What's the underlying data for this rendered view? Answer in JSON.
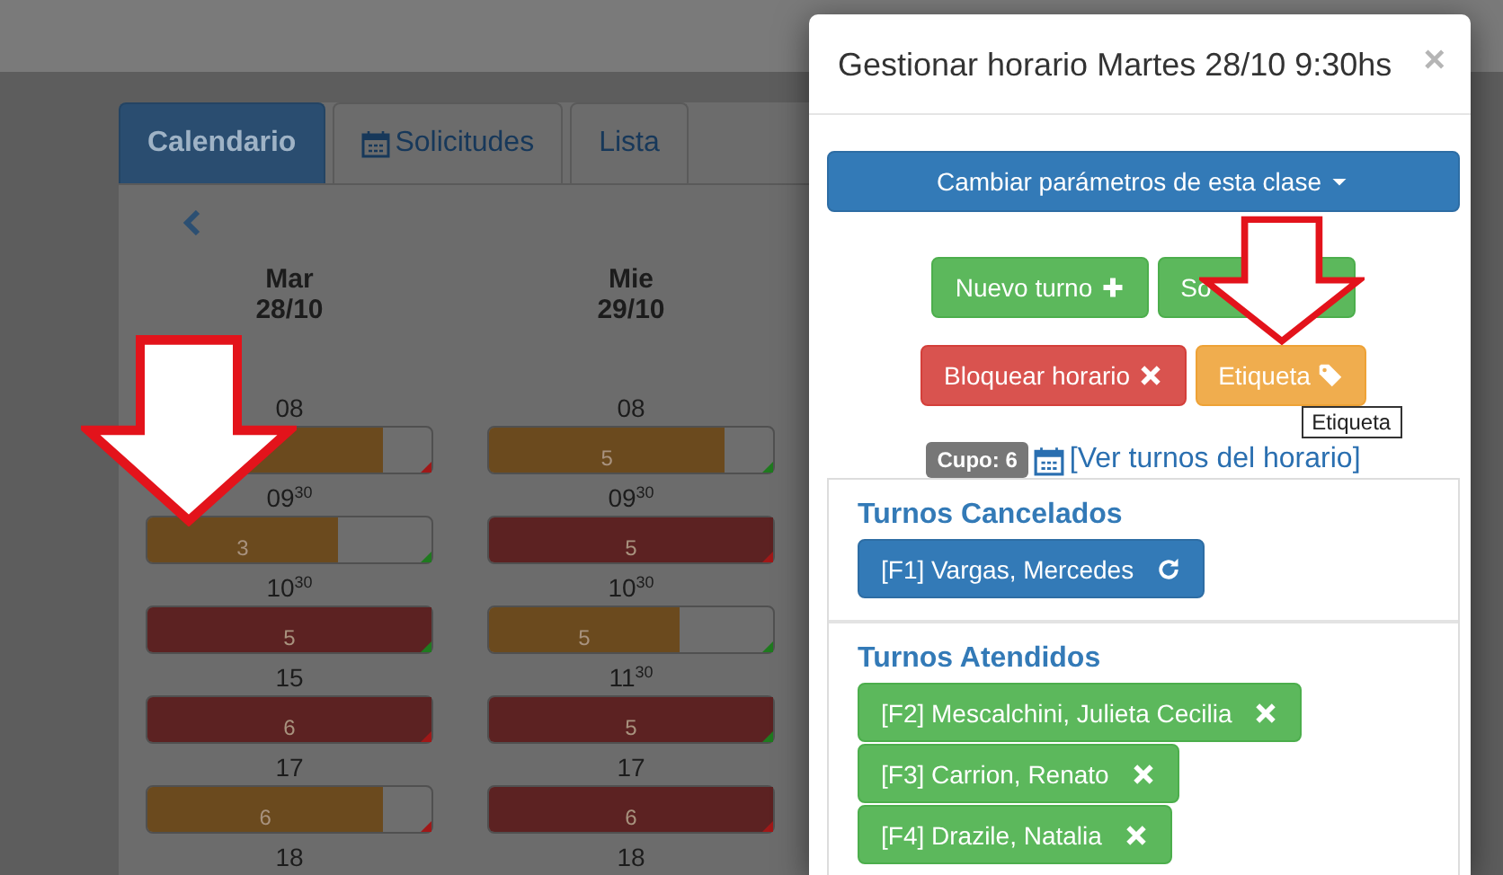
{
  "tabs": [
    {
      "label": "Calendario",
      "selected": true,
      "kind": "calendar"
    },
    {
      "label": "Solicitudes",
      "selected": false,
      "kind": "requests"
    },
    {
      "label": "Lista",
      "selected": false,
      "kind": "list"
    }
  ],
  "calendar": {
    "days": [
      {
        "name": "Mar",
        "date": "28/10",
        "slots": [
          {
            "kind": "bar",
            "time": "08",
            "color": "#6b4a1e",
            "level": 0.83,
            "flag": {
              "color": "#a01818"
            },
            "arrow": false
          },
          {
            "kind": "bar",
            "time": "09$^{30}$",
            "color": "#6b4a1e",
            "level": 0.67,
            "count": "3",
            "flag": {
              "color": "#1f7a1f"
            },
            "arrow": true
          },
          {
            "kind": "bar",
            "time": "10$^{30}$",
            "color": "#5c2222",
            "level": 1,
            "count": "5",
            "flag": {
              "color": "#1f7a1f"
            },
            "arrow": false
          },
          {
            "kind": "bar",
            "time": "15",
            "color": "#5c2222",
            "level": 1,
            "count": "6",
            "flag": {
              "color": "#a01818"
            },
            "arrow": false
          },
          {
            "kind": "bar",
            "time": "17",
            "color": "#6b4a1e",
            "level": 0.83,
            "count": "6",
            "flag": {
              "color": "#a01818"
            },
            "arrow": false
          },
          {
            "kind": "time",
            "time": "18"
          }
        ]
      },
      {
        "name": "Mie",
        "date": "29/10",
        "slots": [
          {
            "kind": "bar",
            "time": "08",
            "color": "#6b4a1e",
            "level": 0.83,
            "count": "5",
            "flag": {
              "color": "#1f7a1f"
            },
            "arrow": false
          },
          {
            "kind": "bar",
            "time": "09$^{30}$",
            "color": "#5c2222",
            "level": 1,
            "count": "5",
            "flag": {
              "color": "#a01818"
            },
            "arrow": false
          },
          {
            "kind": "bar",
            "time": "10$^{30}$",
            "color": "#6b4a1e",
            "level": 0.67,
            "count": "5",
            "flag": {
              "color": "#1f7a1f"
            },
            "arrow": false
          },
          {
            "kind": "bar",
            "time": "11$^{30}$",
            "color": "#5c2222",
            "level": 1,
            "count": "5",
            "flag": {
              "color": "#1f7a1f"
            },
            "arrow": false
          },
          {
            "kind": "bar",
            "time": "17",
            "color": "#5c2222",
            "level": 1,
            "count": "6",
            "flag": {
              "color": "#a01818"
            },
            "arrow": false
          },
          {
            "kind": "time",
            "time": "18"
          }
        ]
      }
    ]
  },
  "modal": {
    "title": "Gestionar horario Martes 28/10 9:30hs",
    "close": "×",
    "param_button": "Cambiar parámetros de esta clase",
    "action_rows": [
      [
        {
          "label": "Nuevo turno",
          "kind": "add",
          "arrow": false
        },
        {
          "label": "So",
          "kind": "partial",
          "arrow": false
        }
      ],
      [
        {
          "label": "Bloquear horario",
          "kind": "block",
          "arrow": false
        },
        {
          "label": "Etiqueta",
          "kind": "label",
          "tooltip": "Etiqueta",
          "arrow": true
        }
      ]
    ],
    "quota_badge": "Cupo: 6",
    "schedule_link": "[Ver turnos del horario]",
    "sections": [
      {
        "title": "Turnos Cancelados",
        "kind": "cancelled",
        "items": [
          "[F1] Vargas, Mercedes"
        ]
      },
      {
        "title": "Turnos Atendidos",
        "kind": "attended",
        "items": [
          "[F2] Mescalchini, Julieta Cecilia",
          "[F3] Carrion, Renato",
          "[F4] Drazile, Natalia"
        ]
      }
    ]
  }
}
